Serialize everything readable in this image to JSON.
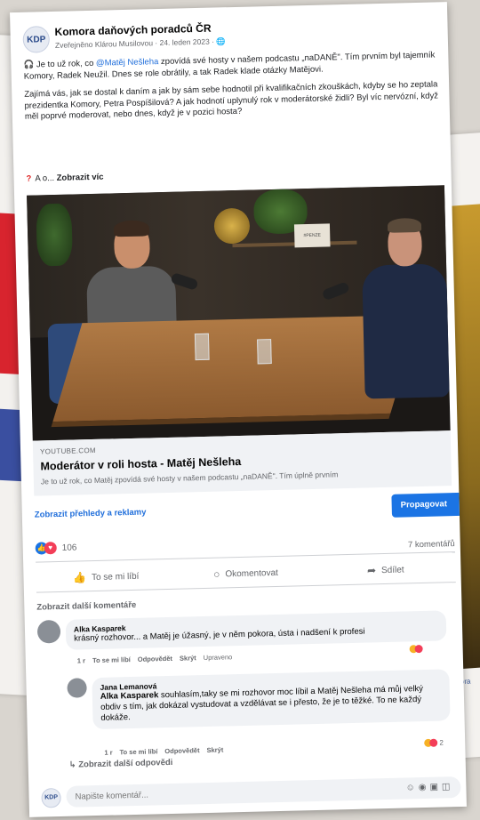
{
  "post": {
    "page_name": "Komora daňových poradců ČR",
    "page_initials": "KDP",
    "meta": "Zveřejněno Klárou Musilovou · 24. leden 2023 ·",
    "para1_a": "Je to už rok, co ",
    "mention": "@Matěj Nešleha",
    "para1_b": " zpovídá své hosty v našem podcastu „naDANĚ\". Tím prvním byl tajemník Komory, Radek Neužil. Dnes se role obrátily, a tak Radek klade otázky Matějovi.",
    "para2": "Zajímá vás, jak se dostal k daním a jak by sám sebe hodnotil při kvalifikačních zkouškách, kdyby se ho zeptala prezidentka Komory, Petra Pospíšilová? A jak hodnotí uplynulý rok v moderátorské židli? Byl víc nervózní, když měl poprvé moderovat, nebo dnes, když je v pozici hosta?",
    "more_prefix": "A o...",
    "more_label": "Zobrazit víc"
  },
  "video": {
    "sign_text": "#PENZE"
  },
  "link": {
    "domain": "YOUTUBE.COM",
    "title": "Moderátor v roli hosta - Matěj Nešleha",
    "description": "Je to už rok, co Matěj zpovídá své hosty v našem podcastu „naDANĚ\". Tím úplně prvním"
  },
  "insights_label": "Zobrazit přehledy a reklamy",
  "promote_label": "Propagovat",
  "reactions": {
    "count": "106",
    "comments": "7 komentářů"
  },
  "actions": {
    "like": "To se mi líbí",
    "comment": "Okomentovat",
    "share": "Sdílet"
  },
  "more_comments_label": "Zobrazit další komentáře",
  "comments": [
    {
      "name": "Alka Kasparek",
      "text": "krásný rozhovor... a Matěj je úžasný, je v něm pokora, ústa i nadšení k profesi",
      "time": "1 r",
      "like": "To se mi líbí",
      "reply": "Odpovědět",
      "hide": "Skrýt",
      "edited": "Upraveno"
    },
    {
      "name": "Jana Lemanová",
      "tag": "Alka Kasparek",
      "text": " souhlasím,taky se mi rozhovor moc líbil a Matěj Nešleha má můj velký obdiv s tím, jak dokázal vystudovat a vzdělávat se i přesto, že je to těžké. To ne každý dokáže.",
      "time": "1 r",
      "like": "To se mi líbí",
      "reply": "Odpovědět",
      "hide": "Skrýt",
      "reactions": "2"
    }
  ],
  "more_replies_label": "Zobrazit další odpovědi",
  "compose": {
    "placeholder": "Napište komentář..."
  },
  "background_right": {
    "meta": "Zobra",
    "count": "61"
  },
  "colors": {
    "accent": "#1b74e4",
    "link": "#216fdb",
    "love": "#f33e58"
  }
}
